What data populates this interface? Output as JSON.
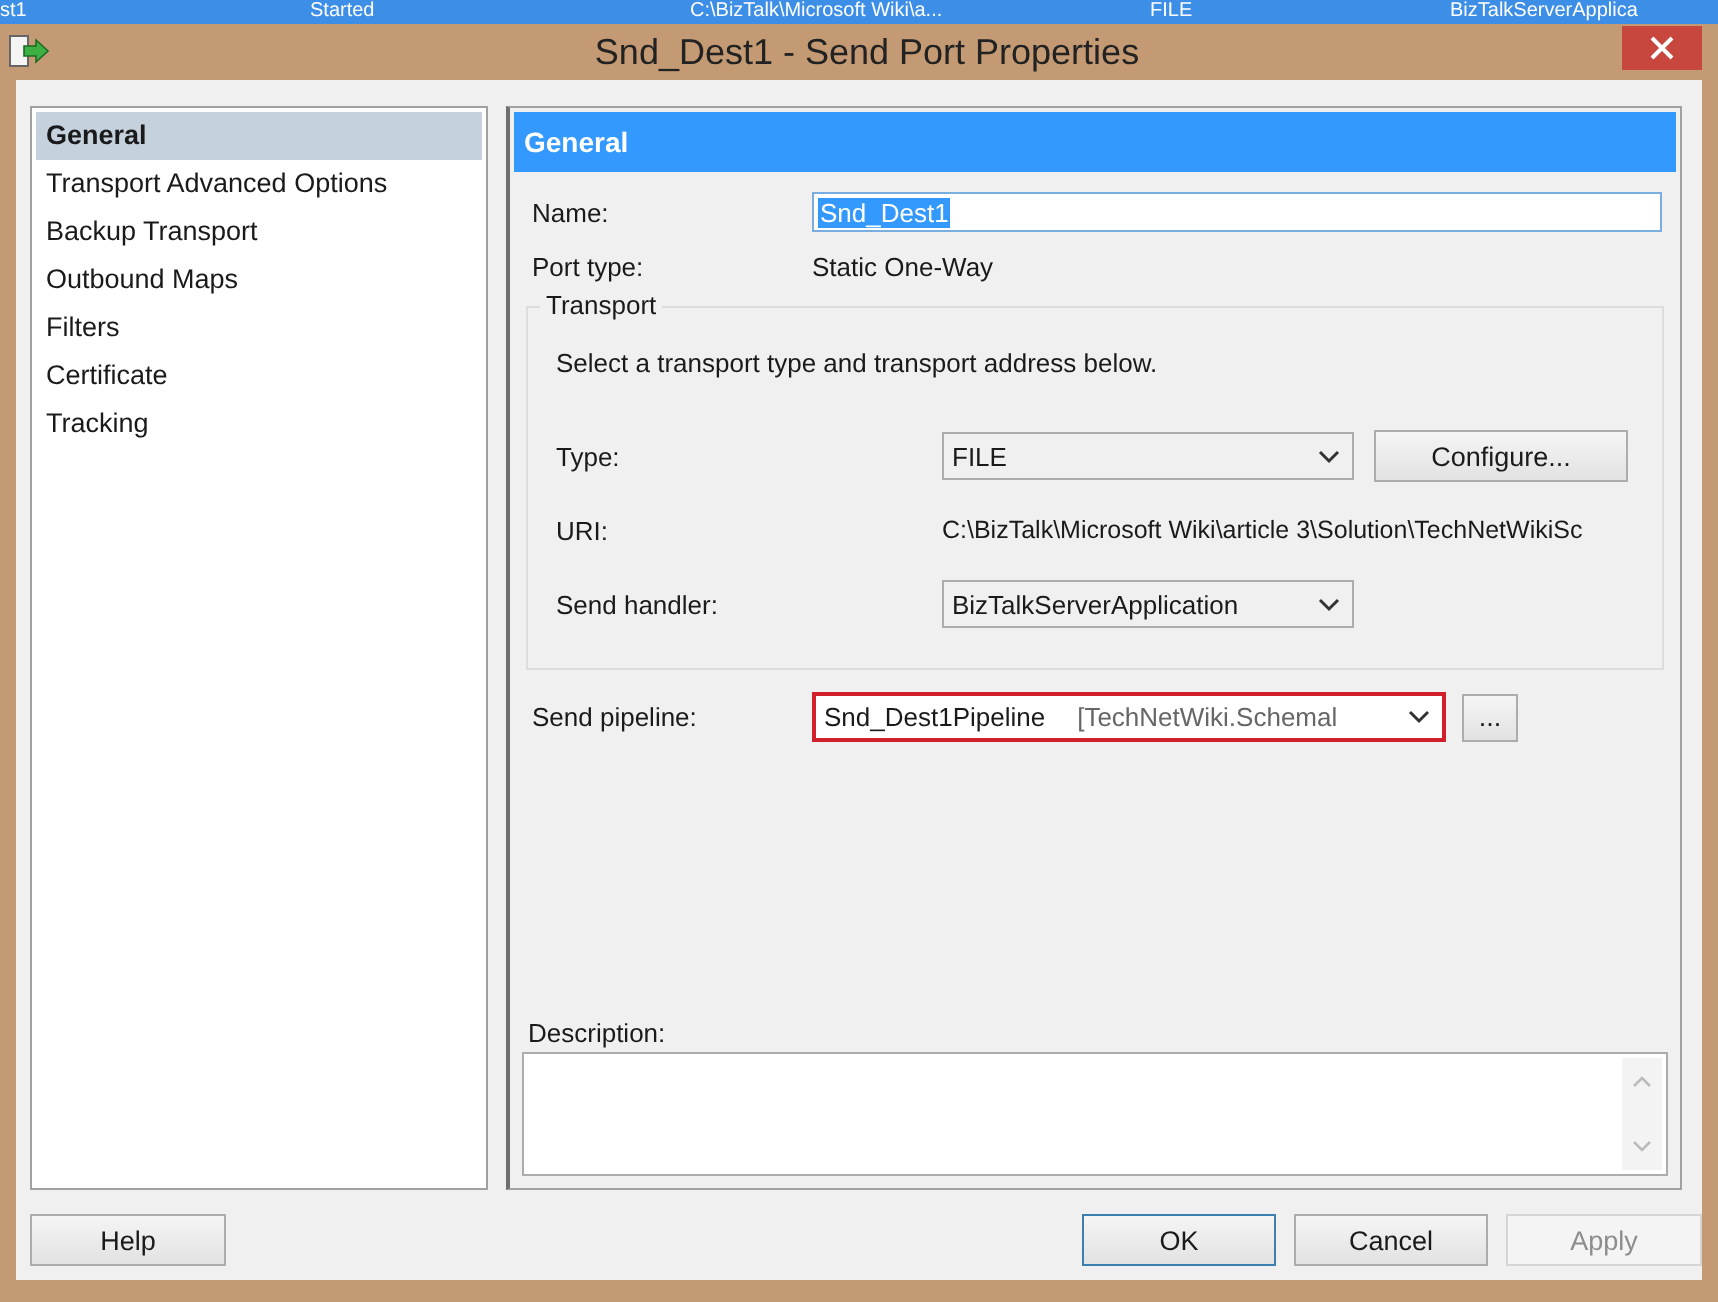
{
  "background_row": {
    "cells": [
      "st1",
      "Started",
      "C:\\BizTalk\\Microsoft Wiki\\a...",
      "FILE",
      "BizTalkServerApplica"
    ]
  },
  "window": {
    "title": "Snd_Dest1 - Send Port Properties"
  },
  "sidebar": {
    "items": [
      {
        "label": "General",
        "selected": true
      },
      {
        "label": "Transport Advanced Options",
        "selected": false
      },
      {
        "label": "Backup Transport",
        "selected": false
      },
      {
        "label": "Outbound Maps",
        "selected": false
      },
      {
        "label": "Filters",
        "selected": false
      },
      {
        "label": "Certificate",
        "selected": false
      },
      {
        "label": "Tracking",
        "selected": false
      }
    ]
  },
  "panel": {
    "header": "General",
    "name": {
      "label": "Name:",
      "value": "Snd_Dest1",
      "value_selected": true
    },
    "port_type": {
      "label": "Port type:",
      "value": "Static One-Way"
    },
    "transport": {
      "legend": "Transport",
      "hint": "Select a transport type and transport address below.",
      "type": {
        "label": "Type:",
        "value": "FILE",
        "button": "Configure..."
      },
      "uri": {
        "label": "URI:",
        "value": "C:\\BizTalk\\Microsoft Wiki\\article 3\\Solution\\TechNetWikiSc"
      },
      "send_handler": {
        "label": "Send handler:",
        "value": "BizTalkServerApplication"
      }
    },
    "send_pipeline": {
      "label": "Send pipeline:",
      "value": "Snd_Dest1Pipeline",
      "assembly": "[TechNetWiki.Schemal",
      "highlighted": true,
      "button": "..."
    },
    "description": {
      "label": "Description:"
    }
  },
  "buttons": [
    {
      "label": "Help",
      "disabled": false,
      "default": false
    },
    {
      "label": "OK",
      "disabled": false,
      "default": true
    },
    {
      "label": "Cancel",
      "disabled": false,
      "default": false
    },
    {
      "label": "Apply",
      "disabled": true,
      "default": false
    }
  ]
}
